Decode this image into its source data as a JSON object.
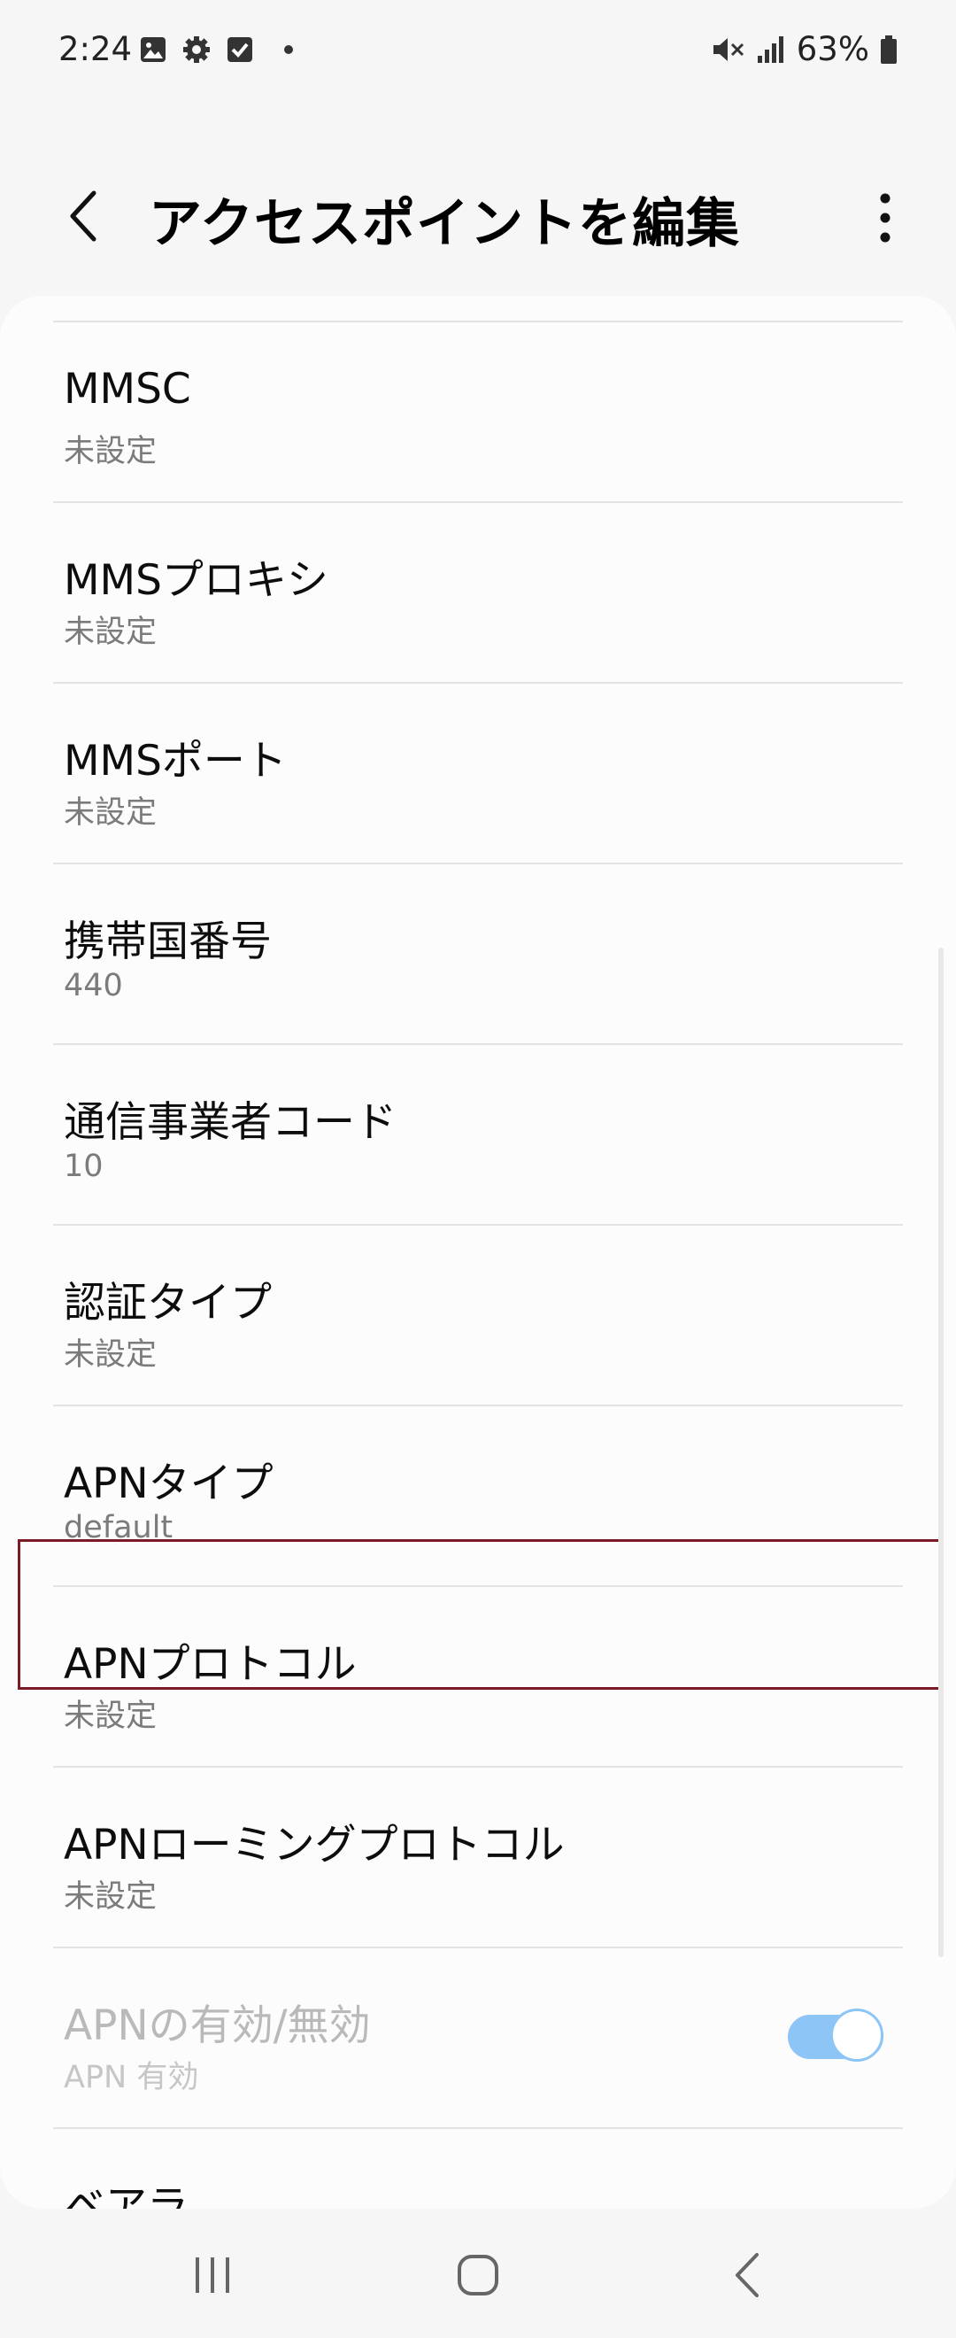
{
  "status_bar": {
    "time": "2:24",
    "battery": "63%",
    "icons": [
      "gallery-icon",
      "settings-gear-icon",
      "checkbox-icon",
      "dot-icon",
      "mute-icon",
      "signal-icon",
      "battery-icon"
    ]
  },
  "header": {
    "title": "アクセスポイントを編集",
    "back_icon": "chevron-left-icon",
    "more_icon": "more-vertical-icon"
  },
  "list": {
    "items": [
      {
        "title": "MMSC",
        "value": "未設定"
      },
      {
        "title": "MMSプロキシ",
        "value": "未設定"
      },
      {
        "title": "MMSポート",
        "value": "未設定"
      },
      {
        "title": "携帯国番号",
        "value": "440"
      },
      {
        "title": "通信事業者コード",
        "value": "10"
      },
      {
        "title": "認証タイプ",
        "value": "未設定",
        "highlighted": true
      },
      {
        "title": "APNタイプ",
        "value": "default"
      },
      {
        "title": "APNプロトコル",
        "value": "未設定"
      },
      {
        "title": "APNローミングプロトコル",
        "value": "未設定"
      },
      {
        "title": "APNの有効/無効",
        "value": "APN 有効",
        "disabled": true,
        "toggle_on": true
      },
      {
        "title": "ベアラ",
        "value": ""
      }
    ]
  },
  "colors": {
    "highlight_border": "#7b1b27",
    "toggle_on": "#8dc5f7",
    "background": "#f6f6f6",
    "card": "#fcfcfc"
  },
  "nav_bar": {
    "icons": [
      "recent-apps-icon",
      "home-icon",
      "back-icon"
    ]
  }
}
